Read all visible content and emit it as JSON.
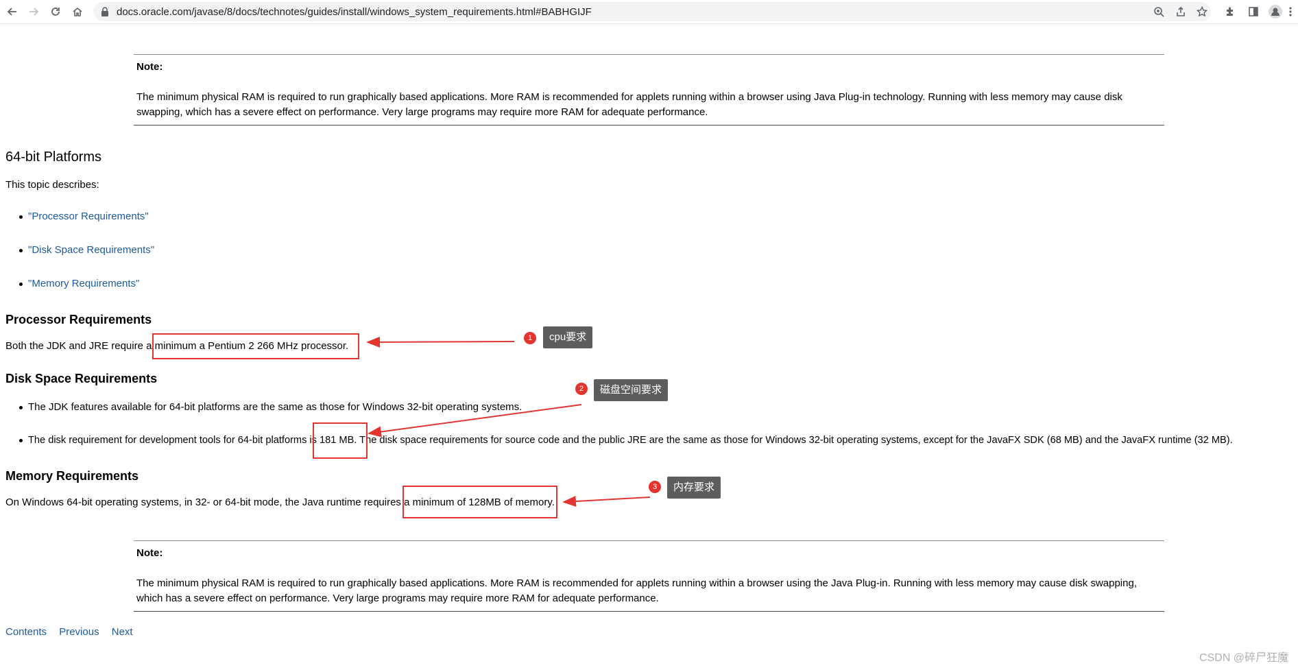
{
  "browser": {
    "url": "docs.oracle.com/javase/8/docs/technotes/guides/install/windows_system_requirements.html#BABHGIJF",
    "icons": [
      "back-icon",
      "forward-icon",
      "reload-icon",
      "home-icon",
      "lock-icon",
      "zoom-icon",
      "share-icon",
      "star-icon",
      "extensions-icon",
      "side-panel-icon",
      "profile-icon",
      "menu-icon"
    ]
  },
  "note_top": {
    "title": "Note:",
    "line1": "The minimum physical RAM is required to run graphically based applications. More RAM is recommended for applets running within a browser using Java Plug-in technology. Running with less memory may cause disk",
    "line2": "swapping, which has a severe effect on performance. Very large programs may require more RAM for adequate performance."
  },
  "section": {
    "heading": "64-bit Platforms",
    "intro": "This topic describes:",
    "links": [
      "\"Processor Requirements\"",
      "\"Disk Space Requirements\"",
      "\"Memory Requirements\""
    ]
  },
  "processor": {
    "heading": "Processor Requirements",
    "text": "Both the JDK and JRE require a minimum a Pentium 2 266 MHz processor."
  },
  "disk": {
    "heading": "Disk Space Requirements",
    "item1": "The JDK features available for 64-bit platforms are the same as those for Windows 32-bit operating systems.",
    "item2": "The disk requirement for development tools for 64-bit platforms is 181 MB. The disk space requirements for source code and the public JRE are the same as those for Windows 32-bit operating systems, except for the JavaFX SDK (68 MB) and the JavaFX runtime (32 MB)."
  },
  "memory": {
    "heading": "Memory Requirements",
    "text": "On Windows 64-bit operating systems, in 32- or 64-bit mode, the Java runtime requires a minimum of 128MB of memory."
  },
  "note_bottom": {
    "title": "Note:",
    "line1": "The minimum physical RAM is required to run graphically based applications. More RAM is recommended for applets running within a browser using the Java Plug-in. Running with less memory may cause disk swapping,",
    "line2": "which has a severe effect on performance. Very large programs may require more RAM for adequate performance."
  },
  "annotations": [
    {
      "number": "1",
      "label": "cpu要求"
    },
    {
      "number": "2",
      "label": "磁盘空间要求"
    },
    {
      "number": "3",
      "label": "内存要求"
    }
  ],
  "footer": {
    "contents": "Contents",
    "previous": "Previous",
    "next": "Next"
  },
  "watermark": "CSDN @碎尸狂魔",
  "colors": {
    "link": "#1d5a9b",
    "annotation_red": "#e3342f",
    "tag_bg": "#5d5d5d"
  }
}
